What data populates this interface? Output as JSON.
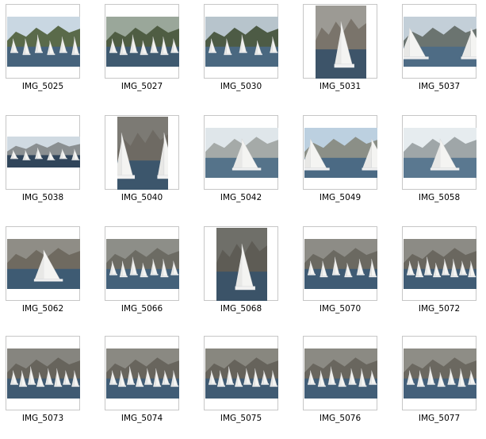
{
  "thumbnails": [
    {
      "label": "IMG_5025",
      "orientation": "landscape"
    },
    {
      "label": "IMG_5027",
      "orientation": "landscape"
    },
    {
      "label": "IMG_5030",
      "orientation": "landscape"
    },
    {
      "label": "IMG_5031",
      "orientation": "portrait"
    },
    {
      "label": "IMG_5037",
      "orientation": "landscape"
    },
    {
      "label": "IMG_5038",
      "orientation": "panorama"
    },
    {
      "label": "IMG_5040",
      "orientation": "portrait"
    },
    {
      "label": "IMG_5042",
      "orientation": "landscape"
    },
    {
      "label": "IMG_5049",
      "orientation": "landscape"
    },
    {
      "label": "IMG_5058",
      "orientation": "landscape"
    },
    {
      "label": "IMG_5062",
      "orientation": "landscape"
    },
    {
      "label": "IMG_5066",
      "orientation": "landscape"
    },
    {
      "label": "IMG_5068",
      "orientation": "portrait"
    },
    {
      "label": "IMG_5070",
      "orientation": "landscape"
    },
    {
      "label": "IMG_5072",
      "orientation": "landscape"
    },
    {
      "label": "IMG_5073",
      "orientation": "landscape"
    },
    {
      "label": "IMG_5074",
      "orientation": "landscape"
    },
    {
      "label": "IMG_5075",
      "orientation": "landscape"
    },
    {
      "label": "IMG_5076",
      "orientation": "landscape"
    },
    {
      "label": "IMG_5077",
      "orientation": "landscape"
    }
  ],
  "colors": {
    "frame_border": "#c7c7c7",
    "background": "#ffffff",
    "caption_text": "#000000"
  }
}
